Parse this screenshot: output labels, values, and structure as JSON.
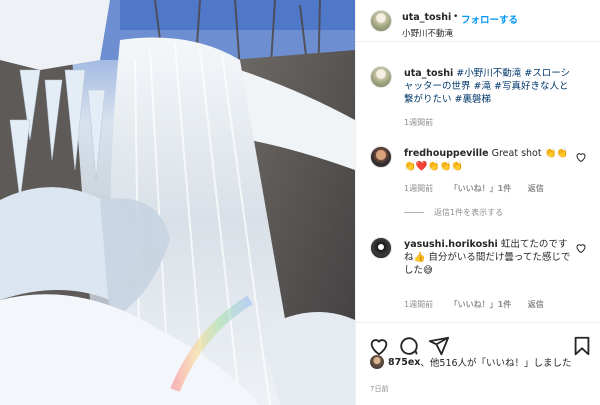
{
  "header": {
    "username": "uta_toshi",
    "dot": "•",
    "follow_label": "フォローする",
    "location": "小野川不動滝"
  },
  "caption": {
    "username": "uta_toshi",
    "text": "#小野川不動滝 #スローシャッターの世界 #滝 #写真好きな人と繋がりたい #裏磐梯",
    "time": "1週間前"
  },
  "comments": [
    {
      "username": "fredhouppeville",
      "text": "Great shot 👏👏👏❤️👏👏👏",
      "time": "1週間前",
      "likes": "「いいね！」1件",
      "reply": "返信"
    },
    {
      "username": "yasushi.horikoshi",
      "text": "虹出てたのですね👍 自分がいる間だけ曇ってた感じでした😅",
      "time": "1週間前",
      "likes": "「いいね！」1件",
      "reply": "返信"
    }
  ],
  "view_replies": "返信1件を表示する",
  "likes_summary": {
    "user": "875ex",
    "text": "、他516人が「いいね！」しました"
  },
  "post_time": "7日前",
  "icons": {
    "like": "heart-icon",
    "comment": "comment-icon",
    "share": "paper-plane-icon",
    "save": "bookmark-icon"
  },
  "colors": {
    "link": "#0095f6",
    "hashtag": "#00376b",
    "muted": "#8e8e8e",
    "heart_red": "#ed4956"
  }
}
